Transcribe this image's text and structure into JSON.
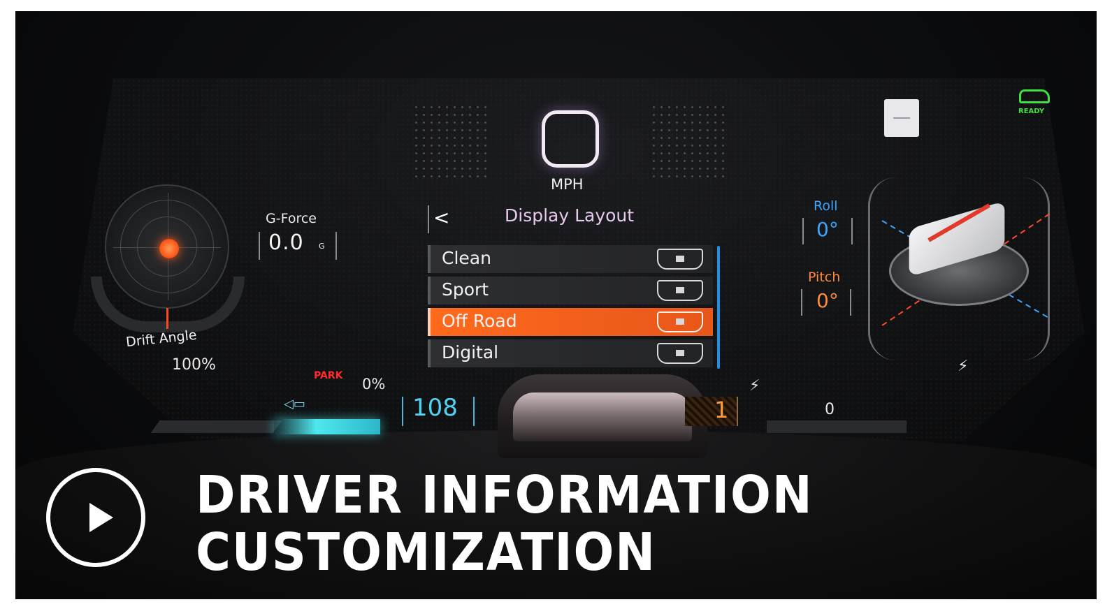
{
  "gauges": {
    "drift_angle_label": "Drift Angle",
    "g_force_label": "G-Force",
    "g_force_value": "0.0",
    "g_force_unit": "G"
  },
  "center": {
    "speed_unit": "MPH",
    "menu_title": "Display Layout",
    "back_label": "<",
    "menu_items": [
      {
        "label": "Clean",
        "selected": false
      },
      {
        "label": "Sport",
        "selected": false
      },
      {
        "label": "Off Road",
        "selected": true
      },
      {
        "label": "Digital",
        "selected": false
      }
    ]
  },
  "right": {
    "ready_label": "READY",
    "roll_label": "Roll",
    "roll_value": "0°",
    "pitch_label": "Pitch",
    "pitch_value": "0°"
  },
  "bottom": {
    "battery_percent": "100%",
    "park_label": "PARK",
    "regen_percent": "0%",
    "range_value": "108",
    "gear_value": "1",
    "power_value": "0"
  },
  "overlay": {
    "title_line1": "DRIVER INFORMATION",
    "title_line2": "CUSTOMIZATION"
  },
  "colors": {
    "accent_orange": "#e8561a",
    "roll_blue": "#3aa6ff",
    "pitch_orange": "#ff8a3a",
    "ready_green": "#3fe03f",
    "range_cyan": "#4fd3f0",
    "park_red": "#ff2a2a"
  },
  "icons": {
    "play": "play-icon",
    "back": "chevron-left-icon",
    "ready": "vehicle-ready-icon",
    "regen": "regen-icon",
    "charge": "lightning-icon"
  }
}
